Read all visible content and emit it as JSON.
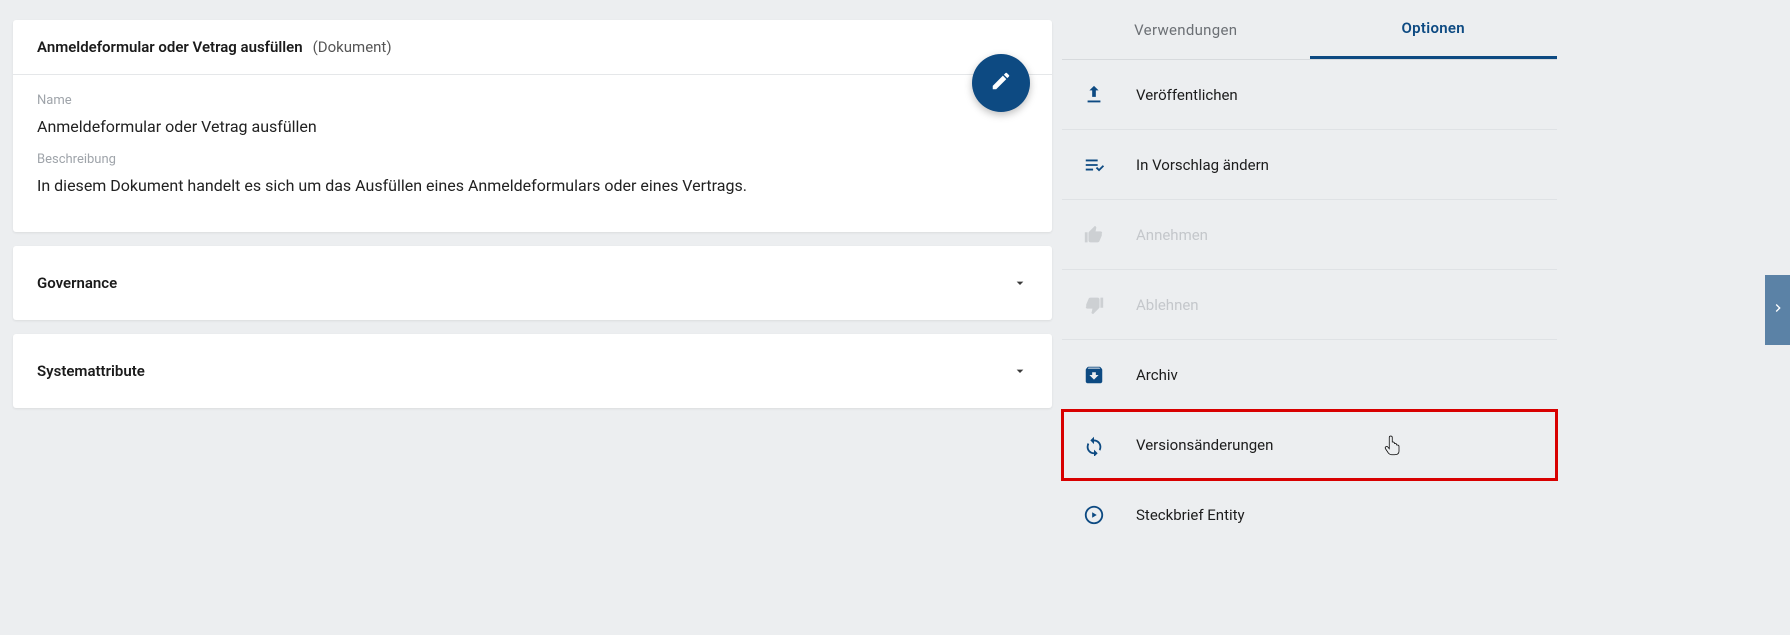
{
  "main": {
    "header": {
      "title": "Anmeldeformular oder Vetrag ausfüllen",
      "subtitle": "(Dokument)"
    },
    "fields": {
      "name_label": "Name",
      "name_value": "Anmeldeformular oder Vetrag ausfüllen",
      "desc_label": "Beschreibung",
      "desc_value": "In diesem Dokument handelt es sich um das Ausfüllen eines Anmeldeformulars oder eines Vertrags."
    },
    "sections": {
      "governance": "Governance",
      "systemattribute": "Systemattribute"
    }
  },
  "side": {
    "tabs": {
      "usages": "Verwendungen",
      "options": "Optionen"
    },
    "options": {
      "publish": "Veröffentlichen",
      "to_proposal": "In Vorschlag ändern",
      "accept": "Annehmen",
      "reject": "Ablehnen",
      "archive": "Archiv",
      "version_changes": "Versionsänderungen",
      "profile_entity": "Steckbrief Entity"
    }
  }
}
